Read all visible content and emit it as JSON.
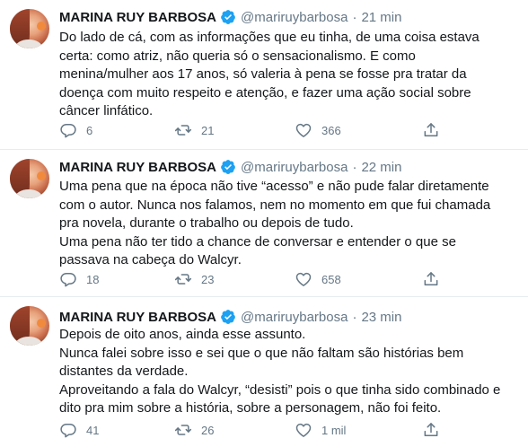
{
  "tweets": [
    {
      "name": "MARINA RUY BARBOSA",
      "handle": "@mariruybarbosa",
      "time": "21 min",
      "lines": [
        "Do lado de cá, com as informações que eu tinha, de uma coisa estava",
        "certa: como atriz, não queria só o sensacionalismo. E como",
        "menina/mulher aos 17 anos, só valeria à pena se fosse pra tratar da",
        "doença com muito respeito e atenção, e fazer uma ação social sobre",
        "câncer linfático."
      ],
      "replies": "6",
      "retweets": "21",
      "likes": "366"
    },
    {
      "name": "MARINA RUY BARBOSA",
      "handle": "@mariruybarbosa",
      "time": "22 min",
      "lines": [
        "Uma pena que na época não tive “acesso” e não pude falar diretamente",
        "com o autor. Nunca nos falamos, nem no momento em que fui chamada",
        "pra novela, durante o trabalho ou depois de tudo.",
        "Uma pena não ter tido a chance de conversar e entender o que se",
        "passava na cabeça do Walcyr."
      ],
      "replies": "18",
      "retweets": "23",
      "likes": "658"
    },
    {
      "name": "MARINA RUY BARBOSA",
      "handle": "@mariruybarbosa",
      "time": "23 min",
      "lines": [
        "Depois de oito anos, ainda esse assunto.",
        "Nunca falei sobre isso e sei que o que não faltam são histórias bem",
        "distantes da verdade.",
        "Aproveitando a fala do Walcyr, “desisti” pois o que tinha sido combinado e",
        "dito pra mim sobre a história, sobre a personagem, não foi feito."
      ],
      "replies": "41",
      "retweets": "26",
      "likes": "1 mil"
    }
  ],
  "separator": "·",
  "colors": {
    "text": "#14171a",
    "secondary": "#657786",
    "verified": "#1da1f2",
    "divider": "#e6ecf0"
  },
  "icons": [
    "verified-badge-icon",
    "reply-icon",
    "retweet-icon",
    "like-icon",
    "share-icon"
  ]
}
